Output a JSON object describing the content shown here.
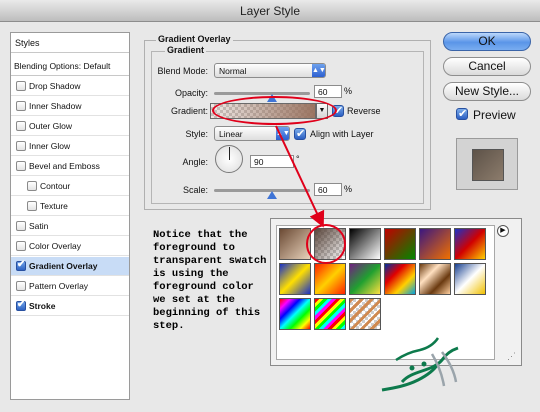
{
  "window": {
    "title": "Layer Style"
  },
  "styles_list": {
    "header": "Styles",
    "blending_options": "Blending Options: Default",
    "items": [
      {
        "label": "Drop Shadow",
        "checked": false,
        "sub": false
      },
      {
        "label": "Inner Shadow",
        "checked": false,
        "sub": false
      },
      {
        "label": "Outer Glow",
        "checked": false,
        "sub": false
      },
      {
        "label": "Inner Glow",
        "checked": false,
        "sub": false
      },
      {
        "label": "Bevel and Emboss",
        "checked": false,
        "sub": false
      },
      {
        "label": "Contour",
        "checked": false,
        "sub": true
      },
      {
        "label": "Texture",
        "checked": false,
        "sub": true
      },
      {
        "label": "Satin",
        "checked": false,
        "sub": false
      },
      {
        "label": "Color Overlay",
        "checked": false,
        "sub": false
      },
      {
        "label": "Gradient Overlay",
        "checked": true,
        "sub": false,
        "selected": true
      },
      {
        "label": "Pattern Overlay",
        "checked": false,
        "sub": false
      },
      {
        "label": "Stroke",
        "checked": true,
        "sub": false
      }
    ]
  },
  "panel": {
    "group_title": "Gradient Overlay",
    "subgroup_title": "Gradient",
    "blend_mode_label": "Blend Mode:",
    "blend_mode_value": "Normal",
    "opacity_label": "Opacity:",
    "opacity_value": "60",
    "opacity_unit": "%",
    "opacity_level": 0.6,
    "gradient_label": "Gradient:",
    "reverse_label": "Reverse",
    "style_label": "Style:",
    "style_value": "Linear",
    "align_label": "Align with Layer",
    "angle_label": "Angle:",
    "angle_value": "90",
    "angle_unit": "°",
    "scale_label": "Scale:",
    "scale_value": "60",
    "scale_unit": "%",
    "scale_level": 0.6
  },
  "buttons": {
    "ok": "OK",
    "cancel": "Cancel",
    "new_style": "New Style...",
    "preview": "Preview"
  },
  "annotation": "Notice that the foreground to transparent swatch is using the foreground color we set at the beginning of this step.",
  "colors": {
    "accent_red": "#e0001a",
    "selection_blue": "#c8dcf6",
    "button_blue": "#5a95e8"
  }
}
